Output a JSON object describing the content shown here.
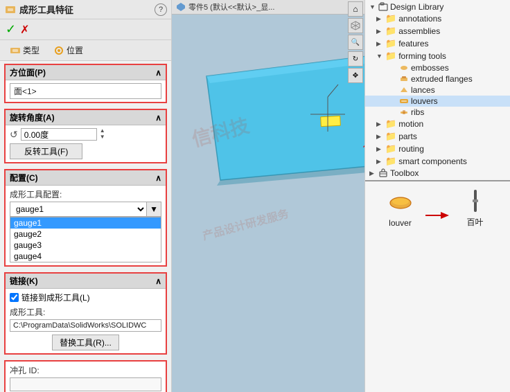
{
  "left_panel": {
    "title": "成形工具特征",
    "help_label": "?",
    "toolbar": {
      "check_label": "✓",
      "cross_label": "✗"
    },
    "tabs": [
      {
        "id": "type",
        "label": "类型"
      },
      {
        "id": "position",
        "label": "位置"
      }
    ],
    "face_section": {
      "header": "方位面(P)",
      "expand_icon": "∧",
      "value": "面<1>"
    },
    "rotation_section": {
      "header": "旋转角度(A)",
      "expand_icon": "∧",
      "angle_value": "0.00度",
      "reverse_button": "反转工具(F)"
    },
    "config_section": {
      "header": "配置(C)",
      "expand_icon": "∧",
      "sub_label": "成形工具配置:",
      "selected_value": "gauge1",
      "options": [
        "gauge1",
        "gauge2",
        "gauge3",
        "gauge4"
      ]
    },
    "link_section": {
      "header": "链接(K)",
      "expand_icon": "∧",
      "checkbox_label": "链接到成形工具(L)",
      "forming_tool_label": "成形工具:",
      "path_value": "C:\\ProgramData\\SolidWorks\\SOLIDWC",
      "replace_button": "替换工具(R)..."
    },
    "punch_section": {
      "header": "冲孔 ID:",
      "value": ""
    }
  },
  "breadcrumb": {
    "text": "零件5 (默认<<默认>_显..."
  },
  "watermark": {
    "lines": [
      "信科技",
      "产品设计研发服务"
    ]
  },
  "right_panel": {
    "tree": {
      "title": "Design Library",
      "items": [
        {
          "id": "annotations",
          "label": "annotations",
          "indent": 1,
          "type": "folder",
          "expanded": false
        },
        {
          "id": "assemblies",
          "label": "assemblies",
          "indent": 1,
          "type": "folder",
          "expanded": false
        },
        {
          "id": "features",
          "label": "features",
          "indent": 1,
          "type": "folder",
          "expanded": false
        },
        {
          "id": "forming_tools",
          "label": "forming tools",
          "indent": 1,
          "type": "folder",
          "expanded": true
        },
        {
          "id": "embosses",
          "label": "embosses",
          "indent": 2,
          "type": "forming",
          "expanded": false
        },
        {
          "id": "extruded_flanges",
          "label": "extruded flanges",
          "indent": 2,
          "type": "forming",
          "expanded": false
        },
        {
          "id": "lances",
          "label": "lances",
          "indent": 2,
          "type": "forming",
          "expanded": false
        },
        {
          "id": "louvers",
          "label": "louvers",
          "indent": 2,
          "type": "forming",
          "expanded": false,
          "selected": true
        },
        {
          "id": "ribs",
          "label": "ribs",
          "indent": 2,
          "type": "forming",
          "expanded": false
        },
        {
          "id": "motion",
          "label": "motion",
          "indent": 1,
          "type": "folder",
          "expanded": false
        },
        {
          "id": "parts",
          "label": "parts",
          "indent": 1,
          "type": "folder",
          "expanded": false
        },
        {
          "id": "routing",
          "label": "routing",
          "indent": 1,
          "type": "folder",
          "expanded": false
        },
        {
          "id": "smart_components",
          "label": "smart components",
          "indent": 1,
          "type": "folder",
          "expanded": false
        },
        {
          "id": "toolbox",
          "label": "Toolbox",
          "indent": 0,
          "type": "toolbox",
          "expanded": false
        }
      ]
    },
    "preview": {
      "items": [
        {
          "id": "louver",
          "label": "louver",
          "type": "louver"
        },
        {
          "id": "baiye",
          "label": "百叶",
          "type": "baiye"
        }
      ]
    }
  }
}
